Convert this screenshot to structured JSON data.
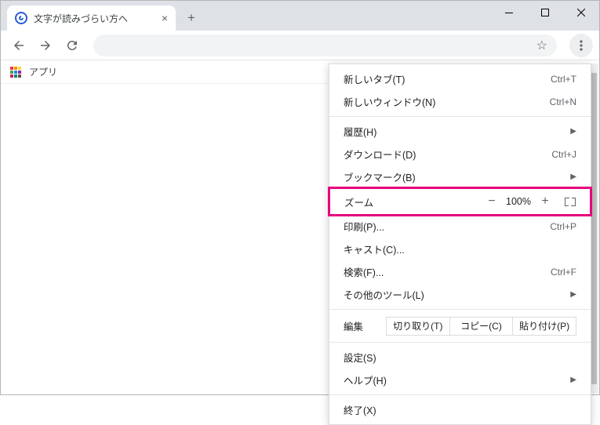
{
  "tab": {
    "title": "文字が読みづらい方へ"
  },
  "bookmarks": {
    "apps": "アプリ"
  },
  "menu": {
    "new_tab": {
      "label": "新しいタブ(T)",
      "shortcut": "Ctrl+T"
    },
    "new_window": {
      "label": "新しいウィンドウ(N)",
      "shortcut": "Ctrl+N"
    },
    "history": {
      "label": "履歴(H)"
    },
    "downloads": {
      "label": "ダウンロード(D)",
      "shortcut": "Ctrl+J"
    },
    "bookmarks": {
      "label": "ブックマーク(B)"
    },
    "zoom": {
      "label": "ズーム",
      "value": "100%"
    },
    "print": {
      "label": "印刷(P)...",
      "shortcut": "Ctrl+P"
    },
    "cast": {
      "label": "キャスト(C)..."
    },
    "find": {
      "label": "検索(F)...",
      "shortcut": "Ctrl+F"
    },
    "more_tools": {
      "label": "その他のツール(L)"
    },
    "edit": {
      "label": "編集",
      "cut": "切り取り(T)",
      "copy": "コピー(C)",
      "paste": "貼り付け(P)"
    },
    "settings": {
      "label": "設定(S)"
    },
    "help": {
      "label": "ヘルプ(H)"
    },
    "exit": {
      "label": "終了(X)"
    }
  }
}
